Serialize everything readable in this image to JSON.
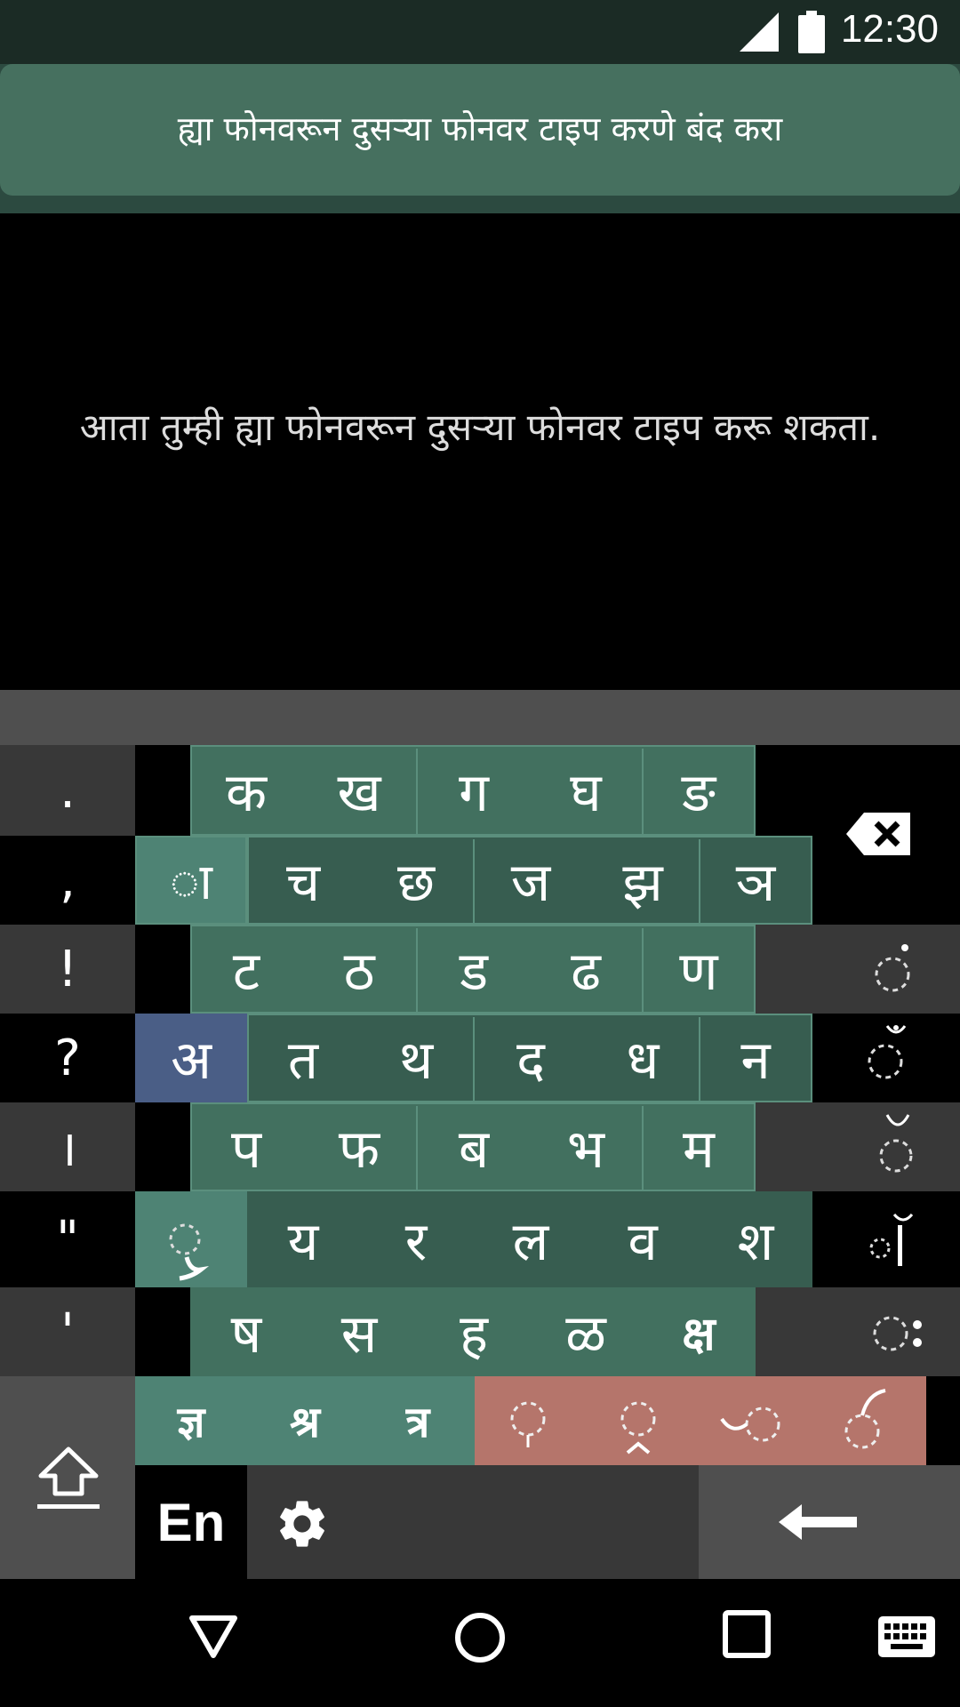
{
  "status": {
    "time": "12:30",
    "signal_icon": "signal-icon",
    "battery_icon": "battery-icon"
  },
  "banner": {
    "text": "ह्या फोनवरून दुसऱ्या फोनवर टाइप करणे बंद करा"
  },
  "main": {
    "message": "आता तुम्ही ह्या फोनवरून दुसऱ्या फोनवर टाइप करू शकता."
  },
  "keyboard": {
    "punct": [
      ".",
      ",",
      "!",
      "?",
      "।",
      "\"",
      "'"
    ],
    "row1": [
      "क",
      "ख",
      "ग",
      "घ",
      "ङ"
    ],
    "row2": [
      "च",
      "छ",
      "ज",
      "झ",
      "ञ"
    ],
    "row3": [
      "ट",
      "ठ",
      "ड",
      "ढ",
      "ण"
    ],
    "row4": [
      "त",
      "थ",
      "द",
      "ध",
      "न"
    ],
    "row5": [
      "प",
      "फ",
      "ब",
      "भ",
      "म"
    ],
    "row6": [
      "य",
      "र",
      "ल",
      "व",
      "श"
    ],
    "row7": [
      "ष",
      "स",
      "ह",
      "ळ",
      "क्ष"
    ],
    "row8_conj": [
      "ज्ञ",
      "श्र",
      "त्र"
    ],
    "vowel_a": "अ",
    "matra_aa": "◌ा",
    "lang": "En",
    "colors": {
      "teal": "#42705f",
      "dark_teal": "#375d50",
      "blue": "#4a5e86",
      "salmon": "#b5756b"
    },
    "icons": [
      "backspace-icon",
      "shift-icon",
      "settings-icon",
      "enter-icon"
    ]
  }
}
